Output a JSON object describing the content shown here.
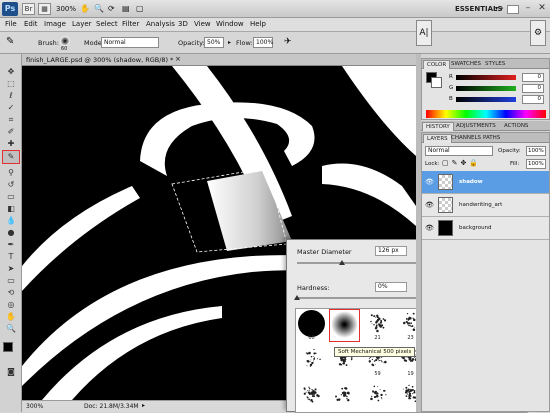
{
  "appbar": {
    "logo": "Ps",
    "zoom": "300%",
    "workspace": "ESSENTIALS",
    "search_placeholder": ""
  },
  "menu": [
    "File",
    "Edit",
    "Image",
    "Layer",
    "Select",
    "Filter",
    "Analysis",
    "3D",
    "View",
    "Window",
    "Help"
  ],
  "options": {
    "brush_label": "Brush:",
    "brush_size": "60",
    "mode_label": "Mode:",
    "mode_value": "Normal",
    "opacity_label": "Opacity:",
    "opacity_value": "50%",
    "flow_label": "Flow:",
    "flow_value": "100%"
  },
  "document": {
    "tab_label": "finish_LARGE.psd @ 300% (shadow, RGB/8) *",
    "status_zoom": "300%",
    "status_doc": "Doc: 21.8M/3.34M"
  },
  "brush_picker": {
    "diameter_label": "Master Diameter",
    "diameter_value": "126 px",
    "diameter_fraction": 0.28,
    "hardness_label": "Hardness:",
    "hardness_value": "0%",
    "hardness_fraction": 0.0,
    "tooltip": "Soft Mechanical 500 pixels",
    "presets": [
      {
        "num": "60",
        "kind": "hard"
      },
      {
        "num": "",
        "kind": "soft"
      },
      {
        "num": "21",
        "kind": "spatter"
      },
      {
        "num": "23",
        "kind": "spatter"
      },
      {
        "num": "23",
        "kind": "spatter"
      },
      {
        "num": "29",
        "kind": "spatter"
      },
      {
        "num": "",
        "kind": "spatter"
      },
      {
        "num": "",
        "kind": "spatter"
      },
      {
        "num": "",
        "kind": "spatter"
      },
      {
        "num": "59",
        "kind": "spatter"
      },
      {
        "num": "19",
        "kind": "spatter"
      },
      {
        "num": "14",
        "kind": "spatter"
      },
      {
        "num": "27",
        "kind": "spatter"
      },
      {
        "num": "39",
        "kind": "spatter"
      },
      {
        "num": "",
        "kind": "spatter"
      },
      {
        "num": "",
        "kind": "spatter"
      },
      {
        "num": "",
        "kind": "spatter"
      },
      {
        "num": "",
        "kind": "spatter"
      },
      {
        "num": "",
        "kind": "spatter"
      },
      {
        "num": "",
        "kind": "spatter"
      },
      {
        "num": "",
        "kind": "spatter"
      }
    ]
  },
  "color_panel": {
    "tabs": [
      "COLOR",
      "SWATCHES",
      "STYLES"
    ],
    "rows": [
      {
        "label": "R",
        "value": "0",
        "color": "#e02020"
      },
      {
        "label": "G",
        "value": "0",
        "color": "#20b020"
      },
      {
        "label": "B",
        "value": "0",
        "color": "#2040e0"
      }
    ]
  },
  "history_tabs": [
    "HISTORY",
    "ADJUSTMENTS",
    "ACTIONS"
  ],
  "layers_panel": {
    "tabs": [
      "LAYERS",
      "CHANNELS",
      "PATHS"
    ],
    "blend_mode": "Normal",
    "opacity_label": "Opacity:",
    "opacity_value": "100%",
    "lock_label": "Lock:",
    "fill_label": "Fill:",
    "fill_value": "100%",
    "layers": [
      {
        "name": "shadow",
        "selected": true,
        "thumb": "checker"
      },
      {
        "name": "handwriting_art",
        "selected": false,
        "thumb": "checker"
      },
      {
        "name": "background",
        "selected": false,
        "thumb": "black"
      }
    ]
  },
  "colors": {
    "accent": "#5a9de5",
    "highlight_box": "#e03030"
  }
}
